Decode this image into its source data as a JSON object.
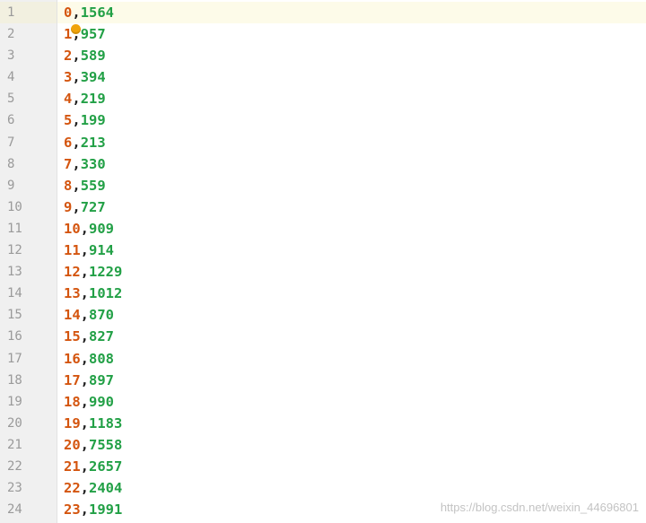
{
  "editor": {
    "lines": [
      {
        "number": "1",
        "key": "0",
        "sep": ",",
        "value": "1564"
      },
      {
        "number": "2",
        "key": "1",
        "sep": ",",
        "value": "957"
      },
      {
        "number": "3",
        "key": "2",
        "sep": ",",
        "value": "589"
      },
      {
        "number": "4",
        "key": "3",
        "sep": ",",
        "value": "394"
      },
      {
        "number": "5",
        "key": "4",
        "sep": ",",
        "value": "219"
      },
      {
        "number": "6",
        "key": "5",
        "sep": ",",
        "value": "199"
      },
      {
        "number": "7",
        "key": "6",
        "sep": ",",
        "value": "213"
      },
      {
        "number": "8",
        "key": "7",
        "sep": ",",
        "value": "330"
      },
      {
        "number": "9",
        "key": "8",
        "sep": ",",
        "value": "559"
      },
      {
        "number": "10",
        "key": "9",
        "sep": ",",
        "value": "727"
      },
      {
        "number": "11",
        "key": "10",
        "sep": ",",
        "value": "909"
      },
      {
        "number": "12",
        "key": "11",
        "sep": ",",
        "value": "914"
      },
      {
        "number": "13",
        "key": "12",
        "sep": ",",
        "value": "1229"
      },
      {
        "number": "14",
        "key": "13",
        "sep": ",",
        "value": "1012"
      },
      {
        "number": "15",
        "key": "14",
        "sep": ",",
        "value": "870"
      },
      {
        "number": "16",
        "key": "15",
        "sep": ",",
        "value": "827"
      },
      {
        "number": "17",
        "key": "16",
        "sep": ",",
        "value": "808"
      },
      {
        "number": "18",
        "key": "17",
        "sep": ",",
        "value": "897"
      },
      {
        "number": "19",
        "key": "18",
        "sep": ",",
        "value": "990"
      },
      {
        "number": "20",
        "key": "19",
        "sep": ",",
        "value": "1183"
      },
      {
        "number": "21",
        "key": "20",
        "sep": ",",
        "value": "7558"
      },
      {
        "number": "22",
        "key": "21",
        "sep": ",",
        "value": "2657"
      },
      {
        "number": "23",
        "key": "22",
        "sep": ",",
        "value": "2404"
      },
      {
        "number": "24",
        "key": "23",
        "sep": ",",
        "value": "1991"
      }
    ],
    "current_line": 1,
    "intention_icon": "lightbulb-icon"
  },
  "watermark": "https://blog.csdn.net/weixin_44696801",
  "colors": {
    "key": "#d4550f",
    "separator": "#202020",
    "value": "#22a046",
    "gutter": "#f0f0f0",
    "current_line": "#fdfbe9",
    "intention_bulb": "#f0a30a"
  }
}
